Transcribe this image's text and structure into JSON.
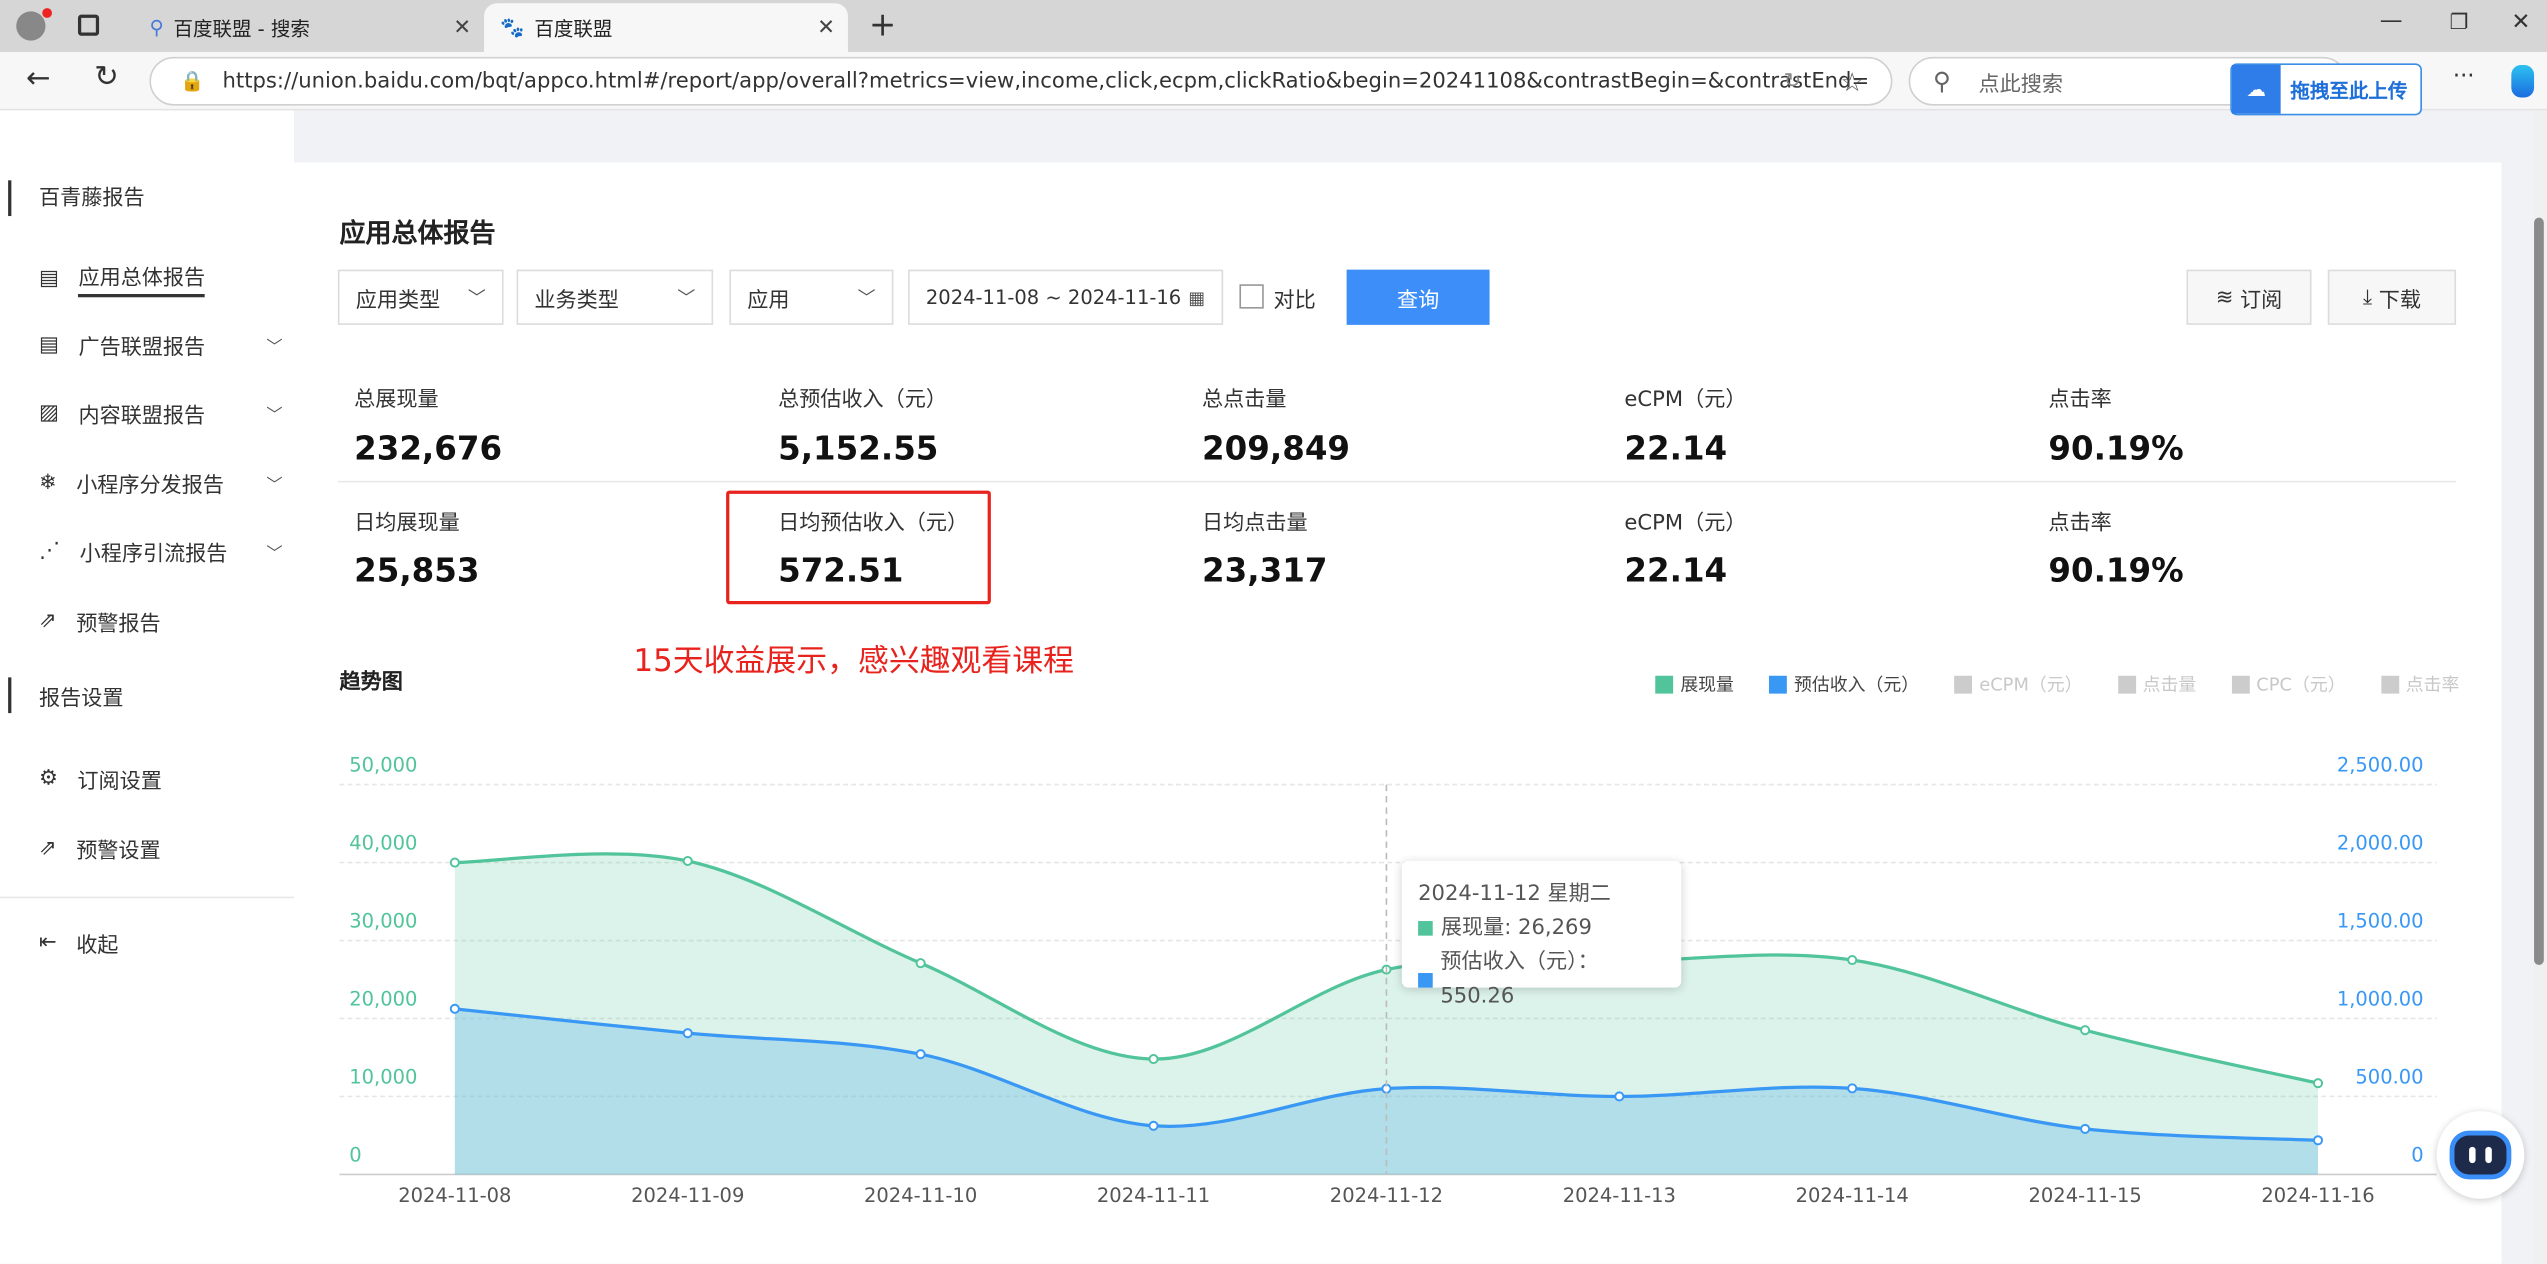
{
  "browser": {
    "tabs": [
      {
        "label": "百度联盟 - 搜索",
        "icon": "search-icon"
      },
      {
        "label": "百度联盟",
        "icon": "baidu-paw-icon"
      }
    ],
    "url": "https://union.baidu.com/bqt/appco.html#/report/app/overall?metrics=view,income,click,ecpm,clickRatio&begin=20241108&contrastBegin=&contrastEnd=",
    "search_placeholder": "点此搜索",
    "extension_label": "拖拽至此上传"
  },
  "sidebar": {
    "section1": "百青藤报告",
    "items1": [
      {
        "label": "应用总体报告",
        "icon": "report-icon",
        "active": true
      },
      {
        "label": "广告联盟报告",
        "icon": "report-icon",
        "expandable": true
      },
      {
        "label": "内容联盟报告",
        "icon": "content-report-icon",
        "expandable": true
      },
      {
        "label": "小程序分发报告",
        "icon": "snowflake-icon",
        "expandable": true
      },
      {
        "label": "小程序引流报告",
        "icon": "share-icon",
        "expandable": true
      },
      {
        "label": "预警报告",
        "icon": "alert-icon"
      }
    ],
    "section2": "报告设置",
    "items2": [
      {
        "label": "订阅设置",
        "icon": "gear-icon"
      },
      {
        "label": "预警设置",
        "icon": "alert-icon"
      }
    ],
    "collapse": "收起"
  },
  "main": {
    "title": "应用总体报告",
    "filters": {
      "app_type": "应用类型",
      "biz_type": "业务类型",
      "app": "应用",
      "date_range": "2024-11-08 ~ 2024-11-16",
      "compare": "对比",
      "compare_checked": false,
      "query": "查询"
    },
    "actions": {
      "subscribe": "订阅",
      "download": "下载"
    },
    "stats_total": [
      {
        "label": "总展现量",
        "value": "232,676"
      },
      {
        "label": "总预估收入（元）",
        "value": "5,152.55"
      },
      {
        "label": "总点击量",
        "value": "209,849"
      },
      {
        "label": "eCPM（元）",
        "value": "22.14"
      },
      {
        "label": "点击率",
        "value": "90.19%"
      }
    ],
    "stats_daily": [
      {
        "label": "日均展现量",
        "value": "25,853"
      },
      {
        "label": "日均预估收入（元）",
        "value": "572.51"
      },
      {
        "label": "日均点击量",
        "value": "23,317"
      },
      {
        "label": "eCPM（元）",
        "value": "22.14"
      },
      {
        "label": "点击率",
        "value": "90.19%"
      }
    ],
    "annotation": "15天收益展示，感兴趣观看课程",
    "annotation_color": "#e8231e"
  },
  "chart_data": {
    "type": "area",
    "title": "趋势图",
    "categories": [
      "2024-11-08",
      "2024-11-09",
      "2024-11-10",
      "2024-11-11",
      "2024-11-12",
      "2024-11-13",
      "2024-11-14",
      "2024-11-15",
      "2024-11-16"
    ],
    "legend": [
      {
        "name": "展现量",
        "active": true,
        "color": "#52c49b"
      },
      {
        "name": "预估收入（元）",
        "active": true,
        "color": "#3a98f5"
      },
      {
        "name": "eCPM（元）",
        "active": false,
        "color": "#cccccc"
      },
      {
        "name": "点击量",
        "active": false,
        "color": "#cccccc"
      },
      {
        "name": "CPC（元）",
        "active": false,
        "color": "#cccccc"
      },
      {
        "name": "点击率",
        "active": false,
        "color": "#cccccc"
      }
    ],
    "legend_position": "top-right",
    "series": [
      {
        "name": "展现量",
        "axis": "left",
        "color": "#52c49b",
        "values": [
          40000,
          40200,
          27100,
          14800,
          26269,
          27300,
          27500,
          18500,
          11700
        ]
      },
      {
        "name": "预估收入（元）",
        "axis": "right",
        "color": "#3a98f5",
        "values": [
          1062,
          906,
          771,
          312,
          550.26,
          500,
          552,
          292,
          219
        ]
      }
    ],
    "y_left": {
      "range": [
        0,
        50000
      ],
      "ticks": [
        "0",
        "10,000",
        "20,000",
        "30,000",
        "40,000",
        "50,000"
      ]
    },
    "y_right": {
      "range": [
        0,
        2500
      ],
      "ticks": [
        "0",
        "500.00",
        "1,000.00",
        "1,500.00",
        "2,000.00",
        "2,500.00"
      ]
    },
    "grid": true,
    "tooltip": {
      "title": "2024-11-12 星期二",
      "rows": [
        {
          "label": "展现量: 26,269",
          "color": "#52c49b"
        },
        {
          "label": "预估收入（元）：550.26",
          "color": "#3a98f5"
        }
      ],
      "index": 4
    }
  }
}
